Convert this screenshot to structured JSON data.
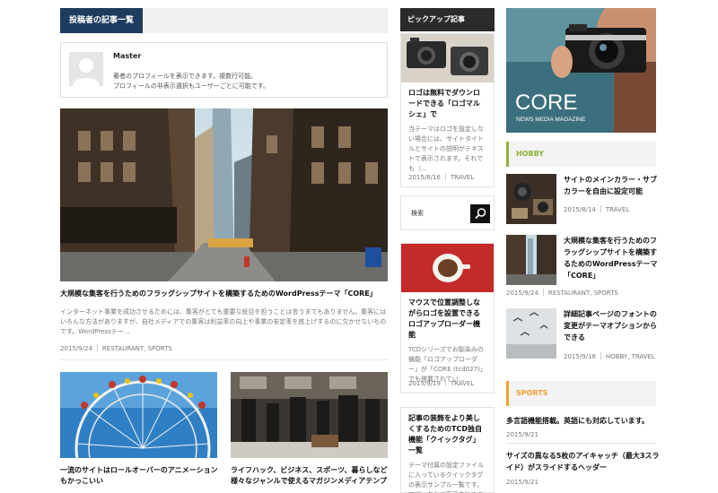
{
  "main": {
    "section_tab": "投稿者の記事一覧",
    "author": {
      "name": "Master",
      "desc_line1": "著者のプロフィールを表示できます。複数行可能。",
      "desc_line2": "プロフィールの非表示選択もユーザーごとに可能です。"
    },
    "hero": {
      "title": "大規模な集客を行うためのフラッグシップサイトを構築するためのWordPressテーマ「CORE」",
      "excerpt": "インターネット事業を成功させるためには、集客がとても重要な役目を担うことは言うまでもありません。集客にはいろんな方法がありますが、自社メディアでの集客は利益率の向上や事業の安定率を底上げするのに欠かせないものです。WordPressテー…",
      "date": "2015/9/24",
      "category": "RESTAURANT, SPORTS"
    },
    "cards": [
      {
        "title": "一流のサイトはロールオーバーのアニメーションもかっこいい"
      },
      {
        "title": "ライフハック、ビジネス、スポーツ、暮らしなど様々なジャンルで使えるマガジンメディアテンプ"
      }
    ]
  },
  "pickup": {
    "heading": "ピックアップ記事",
    "items": [
      {
        "title": "ロゴは無料でダウンロードできる「ロゴマルシェ」で",
        "excerpt": "当テーマはロゴを設定しない場合には、サイトタイトルとサイトの説明がテキストで表示されます。それでも（…",
        "date": "2015/8/16",
        "category": "TRAVEL"
      },
      {
        "title": "マウスで位置調整しながらロゴを設置できるロゴアップローダー機能",
        "excerpt": "TCDシリーズでお馴染みの機能「ロゴアップローダー」が「CORE (tcd027)」でも搭載されてい…",
        "date": "2015/9/19",
        "category": "TRAVEL"
      },
      {
        "title": "記事の装飾をより美しくするためのTCD独自機能「クイックタグ」一覧",
        "excerpt": "テーマ付属の設定ファイルに入っているクイックタグの表示サンプル一覧です。エディタ上に表示されるクイッ…"
      }
    ],
    "search_placeholder": "検索"
  },
  "sidebar": {
    "banner": {
      "logo": "CORE",
      "tagline": "NEWS MEDIA MAGAZINE"
    },
    "hobby": {
      "heading": "HOBBY",
      "color": "#8cb33a",
      "items": [
        {
          "title": "サイトのメインカラー・サブカラーを自由に設定可能",
          "date": "2015/8/14",
          "category": "TRAVEL"
        },
        {
          "title": "大規模な集客を行うためのフラッグシップサイトを構築するためのWordPressテーマ「CORE」",
          "date": "2015/9/24",
          "category": "RESTAURANT, SPORTS"
        },
        {
          "title": "詳細記事ページのフォントの変更がテーマオプションからできる",
          "date": "2015/9/18",
          "category": "HOBBY, TRAVEL"
        }
      ]
    },
    "sports": {
      "heading": "SPORTS",
      "color": "#f0a030",
      "items": [
        {
          "title": "多言語機能搭載。英語にも対応しています。",
          "date": "2015/9/21"
        },
        {
          "title": "サイズの異なる5枚のアイキャッチ（最大3スライド）がスライドするヘッダー",
          "date": "2015/9/21"
        }
      ]
    }
  }
}
